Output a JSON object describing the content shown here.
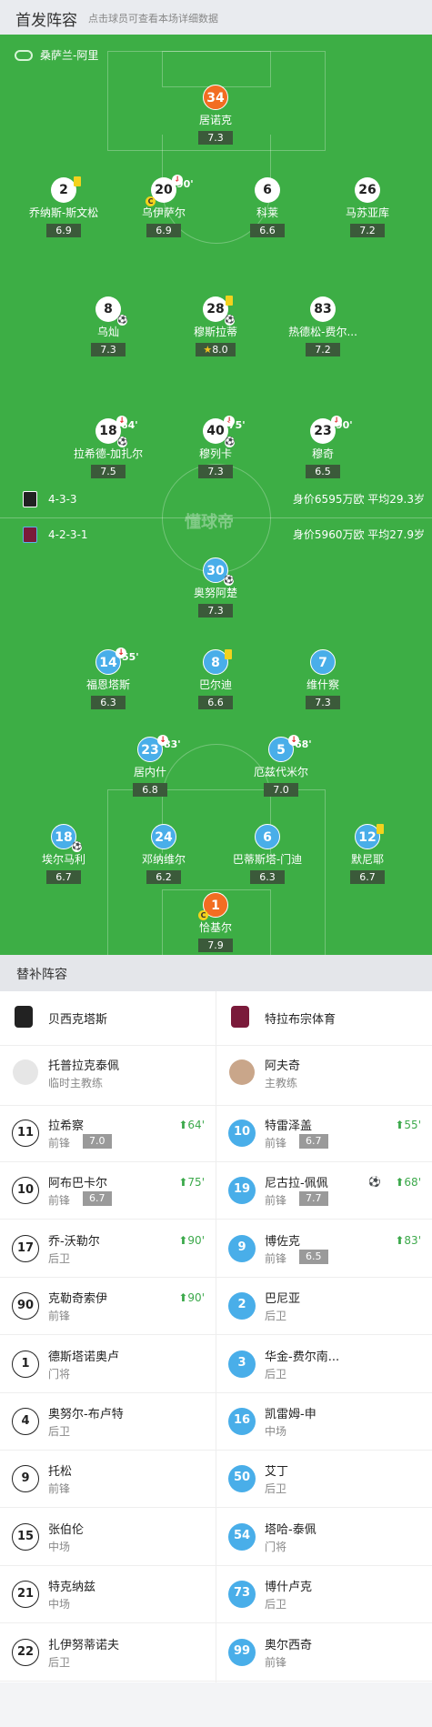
{
  "header": {
    "title": "首发阵容",
    "subtitle": "点击球员可查看本场详细数据"
  },
  "referee": {
    "name": "桑萨兰-阿里",
    "icon": "whistle-icon"
  },
  "watermark": "懂球帝",
  "home": {
    "formation": "4-3-3",
    "value_text": "身价6595万欧 平均29.3岁",
    "players": [
      {
        "num": "34",
        "name": "居诺克",
        "rating": "7.3"
      },
      {
        "num": "2",
        "name": "乔纳斯-斯文松",
        "rating": "6.9"
      },
      {
        "num": "20",
        "name": "乌伊萨尔",
        "rating": "6.9",
        "sub_minute": "90'"
      },
      {
        "num": "6",
        "name": "科莱",
        "rating": "6.6"
      },
      {
        "num": "26",
        "name": "马苏亚库",
        "rating": "7.2"
      },
      {
        "num": "8",
        "name": "乌灿",
        "rating": "7.3"
      },
      {
        "num": "28",
        "name": "穆斯拉蒂",
        "rating": "8.0"
      },
      {
        "num": "83",
        "name": "热德松-费尔...",
        "rating": "7.2"
      },
      {
        "num": "18",
        "name": "拉希德-加扎尔",
        "rating": "7.5",
        "sub_minute": "64'"
      },
      {
        "num": "40",
        "name": "穆列卡",
        "rating": "7.3",
        "sub_minute": "75'"
      },
      {
        "num": "23",
        "name": "穆奇",
        "rating": "6.5",
        "sub_minute": "90'"
      }
    ]
  },
  "away": {
    "formation": "4-2-3-1",
    "value_text": "身价5960万欧 平均27.9岁",
    "players": [
      {
        "num": "30",
        "name": "奥努阿楚",
        "rating": "7.3"
      },
      {
        "num": "14",
        "name": "福恩塔斯",
        "rating": "6.3",
        "sub_minute": "55'"
      },
      {
        "num": "8",
        "name": "巴尔迪",
        "rating": "6.6"
      },
      {
        "num": "7",
        "name": "维什察",
        "rating": "7.3"
      },
      {
        "num": "23",
        "name": "居内什",
        "rating": "6.8",
        "sub_minute": "83'"
      },
      {
        "num": "5",
        "name": "厄兹代米尔",
        "rating": "7.0",
        "sub_minute": "68'"
      },
      {
        "num": "18",
        "name": "埃尔马利",
        "rating": "6.7"
      },
      {
        "num": "24",
        "name": "邓纳维尔",
        "rating": "6.2"
      },
      {
        "num": "6",
        "name": "巴蒂斯塔-门迪",
        "rating": "6.3"
      },
      {
        "num": "12",
        "name": "默尼耶",
        "rating": "6.7"
      },
      {
        "num": "1",
        "name": "恰基尔",
        "rating": "7.9"
      }
    ]
  },
  "bench": {
    "title": "替补阵容",
    "home_team": "贝西克塔斯",
    "away_team": "特拉布宗体育",
    "home_coach": {
      "name": "托普拉克泰佩",
      "role": "临时主教练"
    },
    "away_coach": {
      "name": "阿夫奇",
      "role": "主教练"
    },
    "home_subs": [
      {
        "num": "11",
        "name": "拉希察",
        "pos": "前锋",
        "rating": "7.0",
        "in": "64'"
      },
      {
        "num": "10",
        "name": "阿布巴卡尔",
        "pos": "前锋",
        "rating": "6.7",
        "in": "75'"
      },
      {
        "num": "17",
        "name": "乔-沃勒尔",
        "pos": "后卫",
        "rating": "",
        "in": "90'"
      },
      {
        "num": "90",
        "name": "克勒奇索伊",
        "pos": "前锋",
        "rating": "",
        "in": "90'"
      },
      {
        "num": "1",
        "name": "德斯塔诺奥卢",
        "pos": "门将",
        "rating": "",
        "in": ""
      },
      {
        "num": "4",
        "name": "奥努尔-布卢特",
        "pos": "后卫",
        "rating": "",
        "in": ""
      },
      {
        "num": "9",
        "name": "托松",
        "pos": "前锋",
        "rating": "",
        "in": ""
      },
      {
        "num": "15",
        "name": "张伯伦",
        "pos": "中场",
        "rating": "",
        "in": ""
      },
      {
        "num": "21",
        "name": "特克纳兹",
        "pos": "中场",
        "rating": "",
        "in": ""
      },
      {
        "num": "22",
        "name": "扎伊努蒂诺夫",
        "pos": "后卫",
        "rating": "",
        "in": ""
      }
    ],
    "away_subs": [
      {
        "num": "10",
        "name": "特雷泽盖",
        "pos": "前锋",
        "rating": "6.7",
        "in": "55'"
      },
      {
        "num": "19",
        "name": "尼古拉-佩佩",
        "pos": "前锋",
        "rating": "7.7",
        "in": "68'"
      },
      {
        "num": "9",
        "name": "博佐克",
        "pos": "前锋",
        "rating": "6.5",
        "in": "83'"
      },
      {
        "num": "2",
        "name": "巴尼亚",
        "pos": "后卫",
        "rating": "",
        "in": ""
      },
      {
        "num": "3",
        "name": "华金-费尔南...",
        "pos": "后卫",
        "rating": "",
        "in": ""
      },
      {
        "num": "16",
        "name": "凯雷姆-申",
        "pos": "中场",
        "rating": "",
        "in": ""
      },
      {
        "num": "50",
        "name": "艾丁",
        "pos": "后卫",
        "rating": "",
        "in": ""
      },
      {
        "num": "54",
        "name": "塔哈-泰佩",
        "pos": "门将",
        "rating": "",
        "in": ""
      },
      {
        "num": "73",
        "name": "博什卢克",
        "pos": "后卫",
        "rating": "",
        "in": ""
      },
      {
        "num": "99",
        "name": "奥尔西奇",
        "pos": "前锋",
        "rating": "",
        "in": ""
      }
    ]
  },
  "colors": {
    "pitch": "#3dae45",
    "home_circle": "#ffffff",
    "away_circle": "#49aee9",
    "goalkeeper": "#f26d22",
    "yellow_card": "#f3d21d",
    "sub_in": "#3ca94b"
  }
}
